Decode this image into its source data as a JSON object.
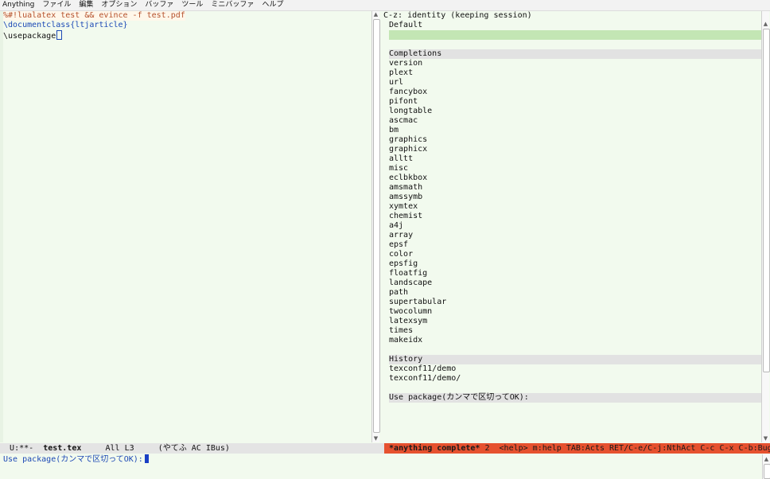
{
  "menubar": [
    "Anything",
    "ファイル",
    "編集",
    "オプション",
    "バッファ",
    "ツール",
    "ミニバッファ",
    "ヘルプ"
  ],
  "editor": {
    "lines": [
      "%#!lualatex test && evince -f test.pdf",
      "\\documentclass{ltjarticle}",
      "\\usepackage"
    ]
  },
  "anything": {
    "header": "C-z: identity (keeping session)",
    "default_label": "Default",
    "completions_label": "Completions",
    "completions": [
      "version",
      "plext",
      "url",
      "fancybox",
      "pifont",
      "longtable",
      "ascmac",
      "bm",
      "graphics",
      "graphicx",
      "alltt",
      "misc",
      "eclbkbox",
      "amsmath",
      "amssymb",
      "xymtex",
      "chemist",
      "a4j",
      "array",
      "epsf",
      "color",
      "epsfig",
      "floatfig",
      "landscape",
      "path",
      "supertabular",
      "twocolumn",
      "latexsym",
      "times",
      "makeidx"
    ],
    "history_label": "History",
    "history": [
      "texconf11/demo",
      "texconf11/demo/"
    ],
    "prompt_label": "Use package(カンマで区切ってOK):"
  },
  "modeline_left": {
    "status": "U:**-",
    "buffer": "test.tex",
    "position": "All L3",
    "modes": "(やてふ AC IBus)"
  },
  "modeline_right": {
    "buffer": "*anything complete*",
    "count": "2",
    "help": "<help> m:help TAB:Acts RET/C-e/C-j:NthAct C-c C-x C-b:BugReport---"
  },
  "minibuffer": {
    "prompt": "Use package(カンマで区切ってOK):"
  },
  "colors": {
    "background": "#f2faee",
    "selection": "#c3e6b4",
    "modeline_active": "#e6512f",
    "keyword": "#1d49b5",
    "comment": "#b5512c"
  }
}
